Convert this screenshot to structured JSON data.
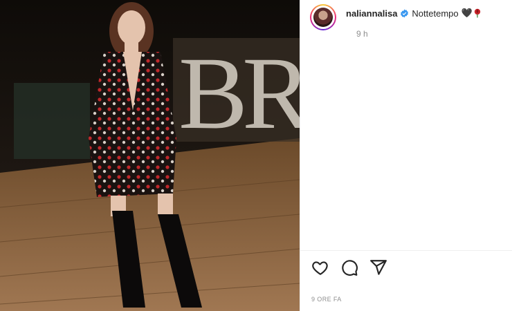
{
  "post": {
    "username": "naliannalisa",
    "caption": "Nottetempo",
    "caption_emoji": [
      "black-heart",
      "rose"
    ],
    "heart_glyph": "🖤",
    "time_short": "9 h",
    "time_long": "9 ORE FA",
    "verified": true
  },
  "photo": {
    "sign_letters": "BRE"
  },
  "actions": {
    "icons": [
      "like-heart-icon",
      "comment-icon",
      "share-icon"
    ]
  },
  "colors": {
    "text": "#262626",
    "muted": "#8e8e8e",
    "verified_blue": "#3897f0",
    "divider": "#efefef"
  }
}
